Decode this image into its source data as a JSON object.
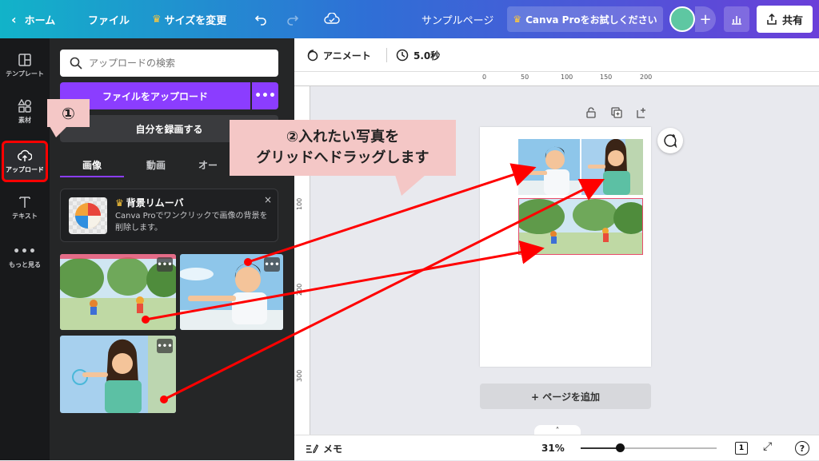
{
  "topbar": {
    "home": "ホーム",
    "file": "ファイル",
    "resize": "サイズを変更",
    "doc_title": "サンプルページ",
    "pro_cta": "Canva Proをお試しください",
    "share": "共有"
  },
  "rail": {
    "items": [
      {
        "label": "テンプレート",
        "icon": "template-icon"
      },
      {
        "label": "素材",
        "icon": "elements-icon"
      },
      {
        "label": "アップロード",
        "icon": "upload-cloud-icon"
      },
      {
        "label": "テキスト",
        "icon": "text-icon"
      },
      {
        "label": "もっと見る",
        "icon": "more-icon"
      }
    ],
    "active": "アップロード"
  },
  "panel": {
    "search_placeholder": "アップロードの検索",
    "upload_button": "ファイルをアップロード",
    "upload_more": "•••",
    "record_button": "自分を録画する",
    "tabs": [
      "画像",
      "動画",
      "オー"
    ],
    "active_tab": "画像",
    "promo": {
      "title": "背景リムーバ",
      "description": "Canva Proでワンクリックで画像の背景を削除します。",
      "close": "×"
    },
    "thumb_more": "•••"
  },
  "editor": {
    "animate": "アニメート",
    "duration": "5.0秒",
    "ruler_top": [
      "0",
      "50",
      "100",
      "150",
      "200"
    ],
    "ruler_left": [
      "100",
      "200",
      "300"
    ],
    "add_page": "+ ページを追加",
    "notes": "メモ",
    "zoom": "31%",
    "page_count": "1",
    "help": "?"
  },
  "annotations": {
    "step1": "①",
    "step2_line1": "②入れたい写真を",
    "step2_line2": "グリッドへドラッグします"
  },
  "colors": {
    "accent": "#8b3dff",
    "highlight": "#ff0000",
    "callout": "#f4c7c6"
  }
}
